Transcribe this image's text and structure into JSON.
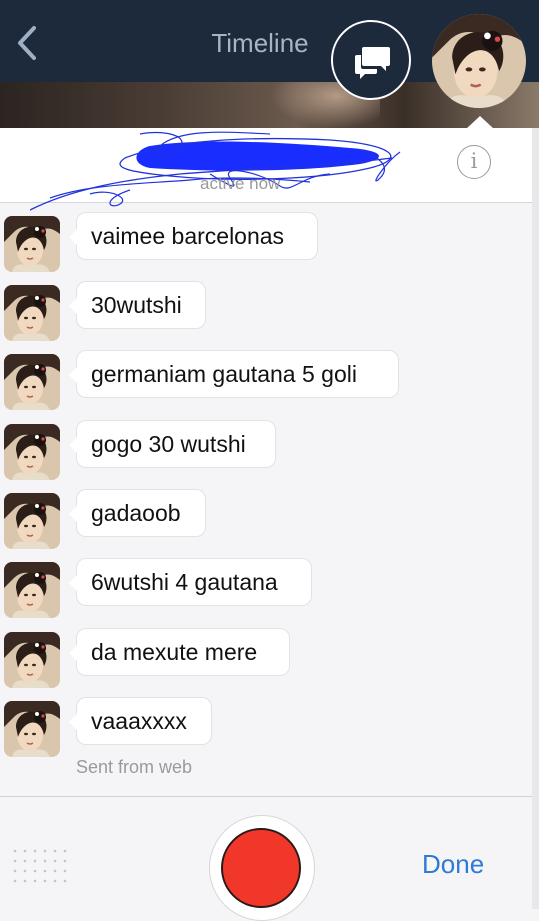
{
  "nav": {
    "title": "Timeline",
    "back_icon": "chevron-left-icon",
    "chat_icon": "chat-bubbles-icon"
  },
  "header": {
    "status": "active now",
    "info_icon": "info-icon",
    "info_glyph": "i"
  },
  "messages": [
    {
      "text": "vaimee barcelonas"
    },
    {
      "text": "30wutshi"
    },
    {
      "text": "germaniam gautana 5 goli"
    },
    {
      "text": "gogo 30 wutshi"
    },
    {
      "text": "gadaoob"
    },
    {
      "text": "6wutshi 4 gautana"
    },
    {
      "text": "da mexute mere"
    },
    {
      "text": "vaaaxxxx"
    }
  ],
  "footer_note": "Sent from web",
  "bottom_bar": {
    "done_label": "Done",
    "record_icon": "record-icon",
    "grid_icon": "dot-grid-icon"
  },
  "colors": {
    "nav_bg": "#1d2a3c",
    "accent": "#2d7bd6",
    "record": "#f0372a"
  }
}
